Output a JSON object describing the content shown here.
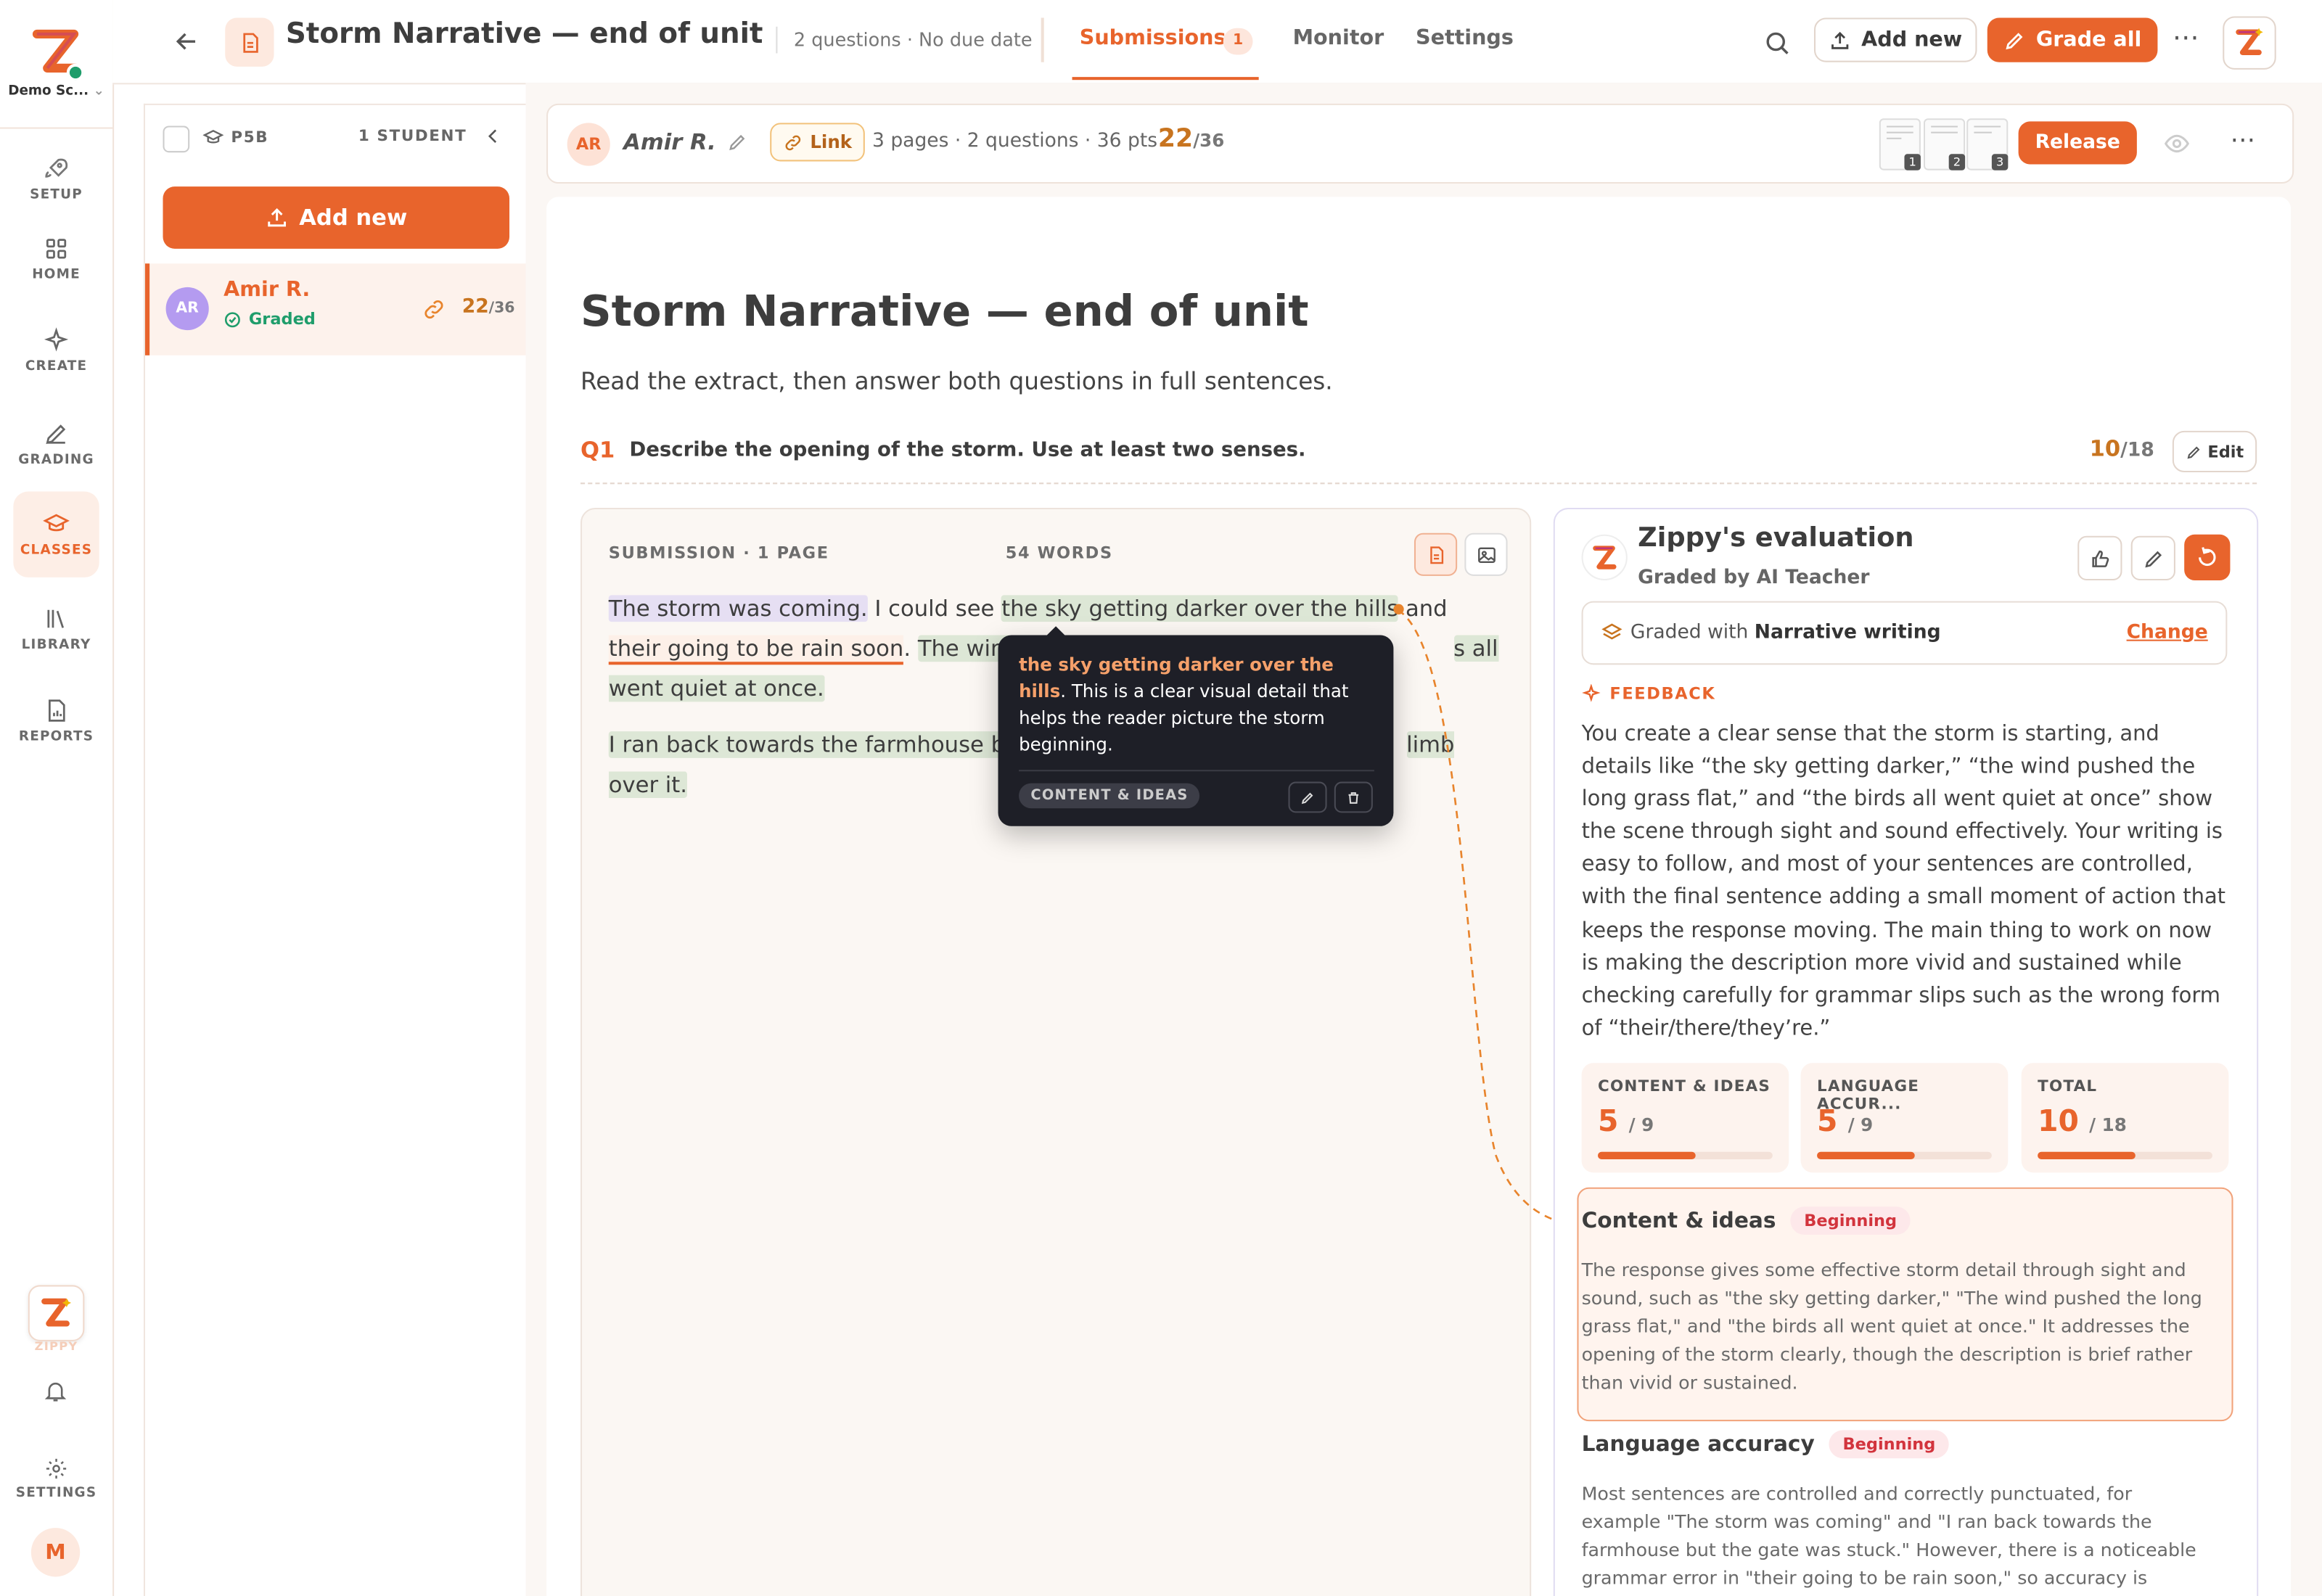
{
  "nav": {
    "school": "Demo Sc...",
    "items": [
      {
        "label": "SETUP"
      },
      {
        "label": "HOME"
      },
      {
        "label": "CREATE"
      },
      {
        "label": "GRADING"
      },
      {
        "label": "CLASSES"
      },
      {
        "label": "LIBRARY"
      },
      {
        "label": "REPORTS"
      }
    ],
    "zippy": "ZIPPY",
    "settings": "SETTINGS",
    "avatar": "M"
  },
  "header": {
    "title": "Storm Narrative — end of unit",
    "meta": "2 questions · No due date",
    "tabs": [
      {
        "label": "Submissions",
        "count": "1"
      },
      {
        "label": "Monitor"
      },
      {
        "label": "Settings"
      }
    ],
    "add_new": "Add new",
    "grade_all": "Grade all"
  },
  "list": {
    "class_name": "P5B",
    "student_count": "1 STUDENT",
    "add_new": "Add new",
    "students": [
      {
        "initials": "AR",
        "name": "Amir R.",
        "status": "Graded",
        "score": "22",
        "total": "/36"
      }
    ]
  },
  "student_bar": {
    "initials": "AR",
    "name": "Amir R.",
    "link": "Link",
    "meta": "3 pages · 2 questions · 36 pts",
    "score": "22",
    "total": "/36",
    "pages": [
      "1",
      "2",
      "3"
    ],
    "release": "Release"
  },
  "doc": {
    "title": "Storm Narrative — end of unit",
    "instructions": "Read the extract, then answer both questions in full sentences.",
    "q_num": "Q1",
    "q_text": "Describe the opening of the storm. Use at least two senses.",
    "q_score": "10",
    "q_total": "/18",
    "edit": "Edit"
  },
  "submission": {
    "header": "SUBMISSION · 1 PAGE",
    "words": "54 WORDS",
    "p1": {
      "s1": "The storm was coming.",
      "s2": " I could see ",
      "s3": "the sky getting darker over the hills",
      "s4": " and ",
      "s5": "their going to be rain soon",
      "s6": ". ",
      "s7": "The wind pus",
      "s8": "s all went quiet at once."
    },
    "p2": {
      "s1": "I ran back towards the farmhouse b",
      "s2": "limb over it."
    }
  },
  "tooltip": {
    "quote": "the sky getting darker over the hills",
    "text": ". This is a clear visual detail that helps the reader picture the storm beginning.",
    "tag": "CONTENT & IDEAS"
  },
  "eval": {
    "title": "Zippy's evaluation",
    "subtitle": "Graded by AI Teacher",
    "rubric_prefix": "Graded with ",
    "rubric": "Narrative writing",
    "change": "Change",
    "feedback_label": "FEEDBACK",
    "feedback": "You create a clear sense that the storm is starting, and details like “the sky getting darker,” “the wind pushed the long grass flat,” and “the birds all went quiet at once” show the scene through sight and sound effectively. Your writing is easy to follow, and most of your sentences are controlled, with the final sentence adding a small moment of action that keeps the response moving. The main thing to work on now is making the description more vivid and sustained while checking carefully for grammar slips such as the wrong form of “their/there/they’re.”",
    "scores": [
      {
        "label": "CONTENT & IDEAS",
        "value": "5",
        "max": "/ 9",
        "fraction": 0.556
      },
      {
        "label": "LANGUAGE ACCUR...",
        "value": "5",
        "max": "/ 9",
        "fraction": 0.556
      },
      {
        "label": "TOTAL",
        "value": "10",
        "max": "/ 18",
        "fraction": 0.556
      }
    ],
    "criteria": [
      {
        "name": "Content & ideas",
        "level": "Beginning",
        "text": "The response gives some effective storm detail through sight and sound, such as \"the sky getting darker,\" \"The wind pushed the long grass flat,\" and \"the birds all went quiet at once.\" It addresses the opening of the storm clearly, though the description is brief rather than vivid or sustained."
      },
      {
        "name": "Language accuracy",
        "level": "Beginning",
        "text": "Most sentences are controlled and correctly punctuated, for example \"The storm was coming\" and \"I ran back towards the farmhouse but the gate was stuck.\" However, there is a noticeable grammar error in \"their going to be rain soon,\" so accuracy is mostly rather than"
      }
    ]
  },
  "colors": {
    "accent": "#e8642c",
    "graded": "#1f9d6b",
    "badge": "#d2343d"
  }
}
